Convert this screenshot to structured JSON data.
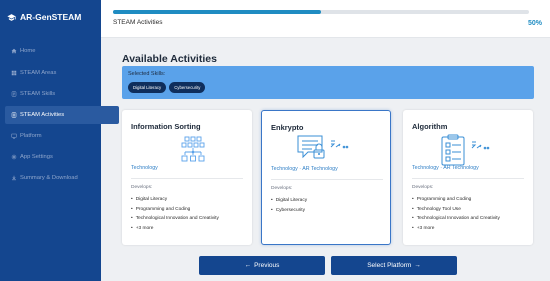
{
  "app": {
    "title": "AR-GenSTEAM"
  },
  "sidebar": {
    "items": [
      {
        "label": "Home",
        "icon": "home-icon"
      },
      {
        "label": "STEAM Areas",
        "icon": "grid-icon"
      },
      {
        "label": "STEAM Skills",
        "icon": "skills-icon"
      },
      {
        "label": "STEAM Activities",
        "icon": "activities-icon",
        "active": true
      },
      {
        "label": "Platform",
        "icon": "platform-icon"
      },
      {
        "label": "App Settings",
        "icon": "gear-icon"
      },
      {
        "label": "Summary & Download",
        "icon": "download-icon"
      }
    ]
  },
  "header": {
    "step_label": "STEAM Activities",
    "progress_percent": 50,
    "progress_text": "50%"
  },
  "main": {
    "heading": "Available Activities",
    "selected_skills_title": "Selected Skills:",
    "selected_skills": [
      "Digital Literacy",
      "Cybersecurity"
    ]
  },
  "cards": [
    {
      "title": "Information Sorting",
      "category": "Technology",
      "develops_label": "Develops:",
      "skills": [
        "Digital Literacy",
        "Programming and Coding",
        "Technological Innovation and Creativity"
      ],
      "more": "+3 more",
      "selected": false
    },
    {
      "title": "Enkrypto",
      "category": "Technology · AR Technology",
      "develops_label": "Develops:",
      "skills": [
        "Digital Literacy",
        "Cybersecurity"
      ],
      "more": "",
      "selected": true
    },
    {
      "title": "Algorithm",
      "category": "Technology · AR Technology",
      "develops_label": "Develops:",
      "skills": [
        "Programming and Coding",
        "Technology Tool Use",
        "Technological Innovation and Creativity"
      ],
      "more": "+3 more",
      "selected": false
    }
  ],
  "footer": {
    "previous_label": "Previous",
    "next_label": "Select Platform"
  },
  "colors": {
    "sidebar": "#14468f",
    "accent": "#1f8cc2",
    "skills_bar": "#5aa2ea",
    "chip": "#0f2e5c"
  }
}
